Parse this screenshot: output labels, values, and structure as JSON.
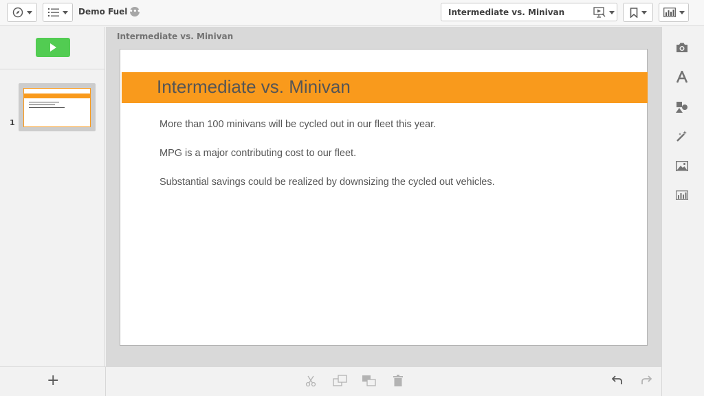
{
  "topbar": {
    "app_name": "Demo Fuel",
    "story_title": "Intermediate vs. Minivan",
    "navigation_icon": "compass-icon",
    "menu_icon": "list-icon",
    "play_story_icon": "presentation-play-icon",
    "bookmark_icon": "bookmark-icon",
    "sheet_icon": "chart-icon"
  },
  "left_panel": {
    "slides": [
      {
        "number": "1",
        "thumbnail_title": "Intermediate vs. Minivan"
      }
    ],
    "add_slide_label": "+"
  },
  "canvas": {
    "sheet_title": "Intermediate vs. Minivan",
    "slide": {
      "heading": "Intermediate vs. Minivan",
      "body_lines": [
        "More than 100 minivans will be cycled out in our fleet this year.",
        "MPG is a major contributing cost to our fleet.",
        "Substantial savings could be realized by downsizing the cycled out vehicles."
      ]
    }
  },
  "bottom_toolbar": {
    "icons": [
      "cut-icon",
      "copy-icon",
      "layer-icon",
      "delete-icon",
      "undo-icon",
      "redo-icon"
    ]
  },
  "right_panel": {
    "icons": [
      "camera-icon",
      "text-icon",
      "shapes-icon",
      "effects-icon",
      "image-icon",
      "chart-icon"
    ]
  },
  "colors": {
    "accent": "#f99a1c",
    "play_green": "#52cc52"
  }
}
